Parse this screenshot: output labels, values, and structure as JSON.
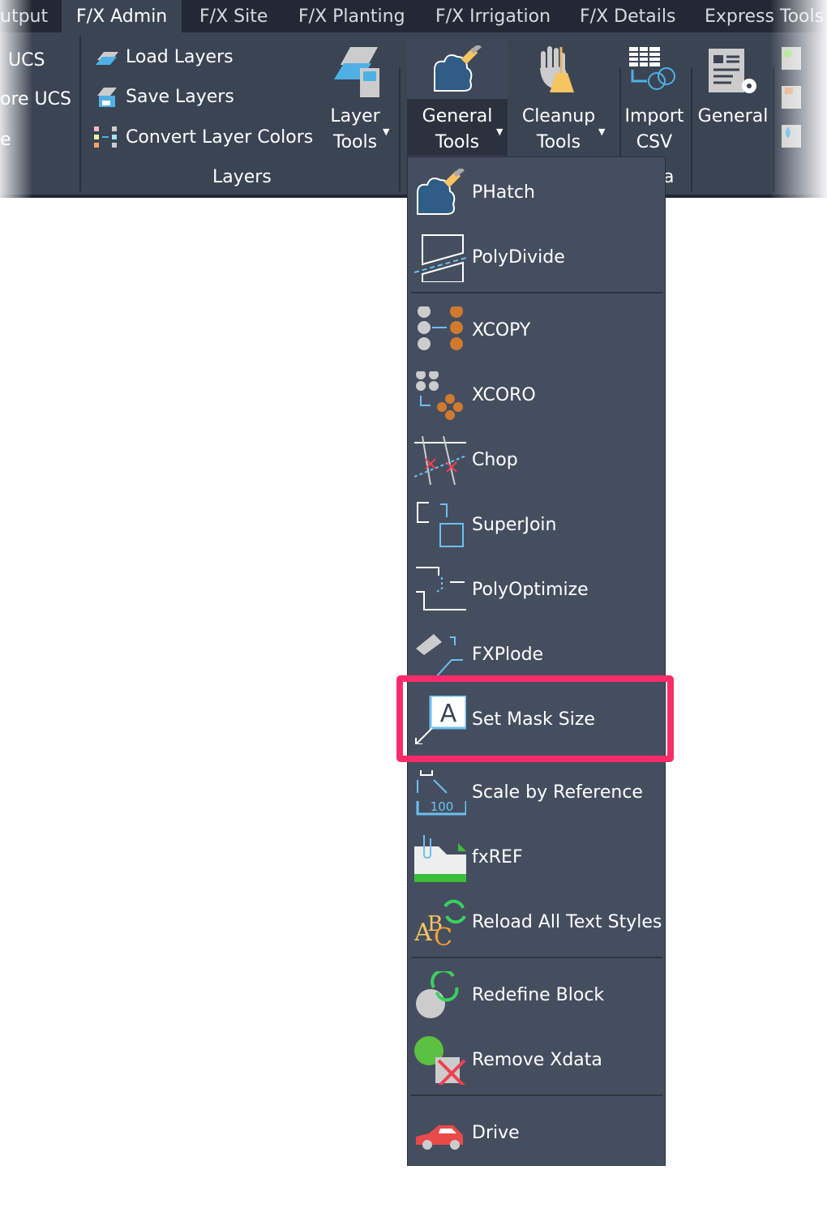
{
  "tabs": [
    {
      "label": "utput"
    },
    {
      "label": "F/X Admin",
      "active": true
    },
    {
      "label": "F/X Site"
    },
    {
      "label": "F/X Planting"
    },
    {
      "label": "F/X Irrigation"
    },
    {
      "label": "F/X Details"
    },
    {
      "label": "Express Tools"
    }
  ],
  "ribbon": {
    "left_partial": [
      "UCS",
      "ore UCS",
      "e"
    ],
    "layers_panel": {
      "items": [
        "Load Layers",
        "Save Layers",
        "Convert Layer Colors"
      ],
      "title": "Layers"
    },
    "layer_tools": [
      "Layer",
      "Tools"
    ],
    "general_tools": [
      "General",
      "Tools"
    ],
    "cleanup_tools": [
      "Cleanup",
      "Tools"
    ],
    "import_csv": [
      "Import",
      "CSV"
    ],
    "general": "General",
    "panel_partial": "a"
  },
  "menu": {
    "items": [
      {
        "label": "PHatch",
        "icon": "phatch-icon"
      },
      {
        "label": "PolyDivide",
        "icon": "polydivide-icon"
      },
      {
        "label": "XCOPY",
        "icon": "xcopy-icon"
      },
      {
        "label": "XCORO",
        "icon": "xcoro-icon"
      },
      {
        "label": "Chop",
        "icon": "chop-icon"
      },
      {
        "label": "SuperJoin",
        "icon": "superjoin-icon"
      },
      {
        "label": "PolyOptimize",
        "icon": "polyoptimize-icon"
      },
      {
        "label": "FXPlode",
        "icon": "fxplode-icon"
      },
      {
        "label": "Set Mask Size",
        "icon": "mask-icon",
        "highlighted": true
      },
      {
        "label": "Scale by Reference",
        "icon": "scale-icon",
        "icon_text": "100"
      },
      {
        "label": "fxREF",
        "icon": "fxref-icon"
      },
      {
        "label": "Reload All Text Styles",
        "icon": "text-styles-icon"
      },
      {
        "label": "Redefine Block",
        "icon": "redefine-block-icon"
      },
      {
        "label": "Remove Xdata",
        "icon": "remove-xdata-icon"
      },
      {
        "label": "Drive",
        "icon": "car-icon"
      }
    ]
  },
  "colors": {
    "highlight": "#fe2b6a",
    "menu_bg": "#454e5f",
    "ribbon_bg": "#3b4453"
  }
}
